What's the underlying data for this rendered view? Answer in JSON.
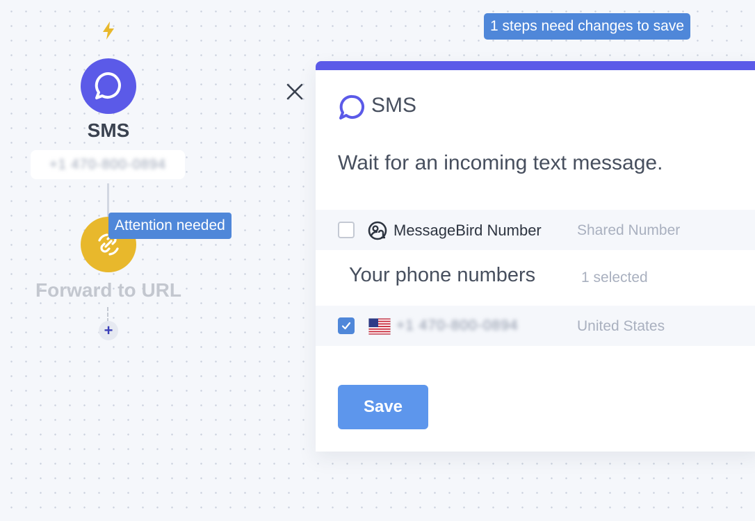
{
  "banner": {
    "text": "1 steps need changes to save"
  },
  "canvas": {
    "trigger_icon": "lightning-bolt-icon",
    "sms_node": {
      "title": "SMS",
      "number": "+1 470-800-0894",
      "icon": "chat-bubble-icon",
      "color": "#5b5ae8"
    },
    "forward_node": {
      "label": "Forward to URL",
      "icon": "link-sync-icon",
      "color": "#e8b82c",
      "attention": "Attention needed"
    },
    "add_step": "+"
  },
  "panel": {
    "accent": "#5b5ae8",
    "title": "SMS",
    "description": "Wait for an incoming text message.",
    "shared_row": {
      "label": "MessageBird Number",
      "tag": "Shared Number",
      "checked": false
    },
    "section_title": "Your phone numbers",
    "selected_count": "1 selected",
    "number_row": {
      "number": "+1 470-800-0894",
      "country": "United States",
      "checked": true,
      "flag": "us-flag-icon"
    },
    "save_label": "Save",
    "save_color": "#5d96ec"
  }
}
